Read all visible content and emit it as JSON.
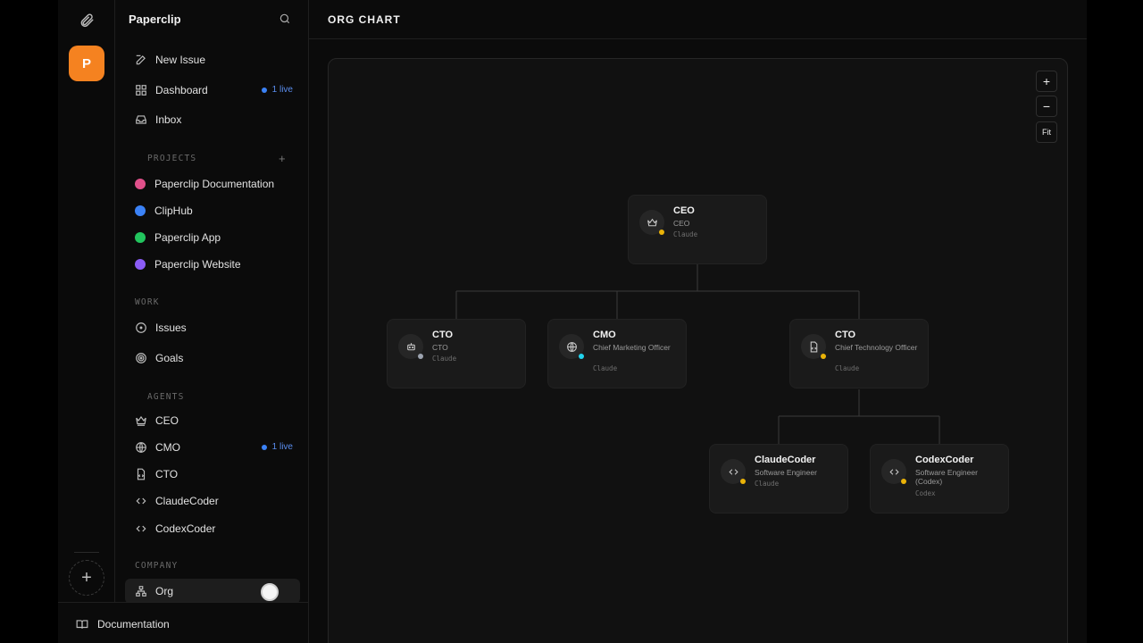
{
  "rail": {
    "company_initial": "P"
  },
  "sidebar": {
    "brand": "Paperclip",
    "nav": [
      {
        "label": "New Issue"
      },
      {
        "label": "Dashboard",
        "badge": "1 live"
      },
      {
        "label": "Inbox"
      }
    ],
    "projects_label": "PROJECTS",
    "projects": [
      {
        "label": "Paperclip Documentation",
        "color": "#e0508a"
      },
      {
        "label": "ClipHub",
        "color": "#3b82f6"
      },
      {
        "label": "Paperclip App",
        "color": "#22c55e"
      },
      {
        "label": "Paperclip Website",
        "color": "#8b5cf6"
      }
    ],
    "work_label": "WORK",
    "work": [
      {
        "label": "Issues"
      },
      {
        "label": "Goals"
      }
    ],
    "agents_label": "AGENTS",
    "agents": [
      {
        "label": "CEO",
        "icon": "crown-icon"
      },
      {
        "label": "CMO",
        "icon": "globe-icon",
        "badge": "1 live"
      },
      {
        "label": "CTO",
        "icon": "file-code-icon"
      },
      {
        "label": "ClaudeCoder",
        "icon": "code-icon"
      },
      {
        "label": "CodexCoder",
        "icon": "code-icon"
      }
    ],
    "company_label": "COMPANY",
    "company": [
      {
        "label": "Org",
        "icon": "org-chart-icon"
      }
    ],
    "documentation": "Documentation"
  },
  "main": {
    "title": "ORG CHART",
    "zoom_in": "+",
    "zoom_out": "−",
    "fit": "Fit"
  },
  "org": {
    "ceo": {
      "name": "CEO",
      "role": "CEO",
      "model": "Claude",
      "status": "#eab308",
      "icon": "crown-icon"
    },
    "cto_a": {
      "name": "CTO",
      "role": "CTO",
      "model": "Claude",
      "status": "#9ca3af",
      "icon": "robot-icon"
    },
    "cmo": {
      "name": "CMO",
      "role": "Chief Marketing Officer",
      "model": "Claude",
      "status": "#22d3ee",
      "icon": "globe-icon"
    },
    "cto_b": {
      "name": "CTO",
      "role": "Chief Technology Officer",
      "model": "Claude",
      "status": "#eab308",
      "icon": "file-code-icon"
    },
    "claudecoder": {
      "name": "ClaudeCoder",
      "role": "Software Engineer",
      "model": "Claude",
      "status": "#eab308",
      "icon": "code-icon"
    },
    "codexcoder": {
      "name": "CodexCoder",
      "role": "Software Engineer (Codex)",
      "model": "Codex",
      "status": "#eab308",
      "icon": "code-icon"
    }
  },
  "colors": {
    "accent": "#f58220",
    "live": "#3b82f6"
  }
}
